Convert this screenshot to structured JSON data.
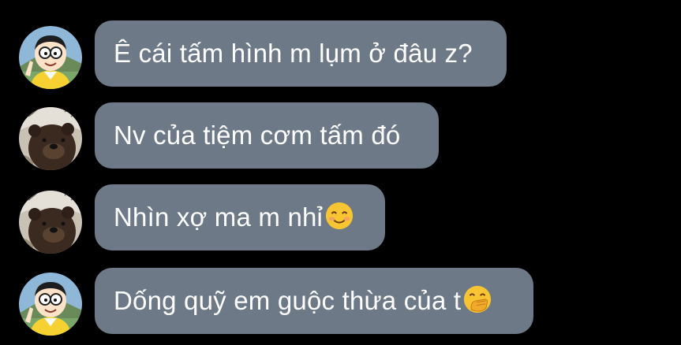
{
  "messages": [
    {
      "sender_avatar": "nobita-avatar",
      "text": "Ê cái tấm hình m lụm ở đâu z?",
      "emoji": ""
    },
    {
      "sender_avatar": "bear-avatar",
      "text": "Nv của tiệm cơm tấm đó",
      "emoji": ""
    },
    {
      "sender_avatar": "bear-avatar",
      "text": "Nhìn xợ ma m nhỉ",
      "emoji": "smiling-face-emoji"
    },
    {
      "sender_avatar": "nobita-avatar",
      "text": "Dống quỹ em guộc thừa của t",
      "emoji": "face-with-hand-over-mouth-emoji"
    }
  ],
  "colors": {
    "background": "#000000",
    "bubble": "#6d7987",
    "text": "#ffffff"
  }
}
